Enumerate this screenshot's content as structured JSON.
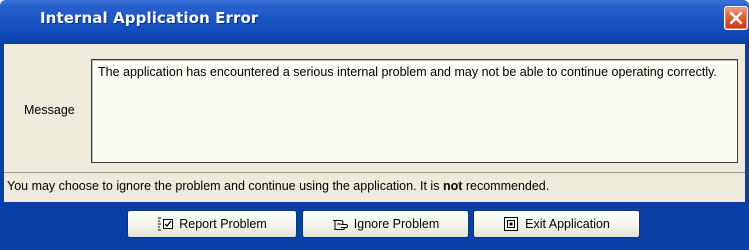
{
  "window": {
    "title": "Internal Application Error"
  },
  "message": {
    "label": "Message",
    "text": "The application has encountered a serious internal problem and may not be able to continue operating correctly."
  },
  "warning": {
    "prefix": "You may choose to ignore the problem and continue using the application. It is ",
    "emphasis": "not",
    "suffix": " recommended."
  },
  "buttons": {
    "report": {
      "label": "Report Problem",
      "icon": "report-icon"
    },
    "ignore": {
      "label": "Ignore Problem",
      "icon": "ignore-icon"
    },
    "exit": {
      "label": "Exit Application",
      "icon": "exit-icon"
    }
  },
  "colors": {
    "titlebar": "#0a3fa6",
    "close_button": "#d2461f",
    "client_background": "#eeeadc",
    "message_background": "#fcfbf3"
  }
}
